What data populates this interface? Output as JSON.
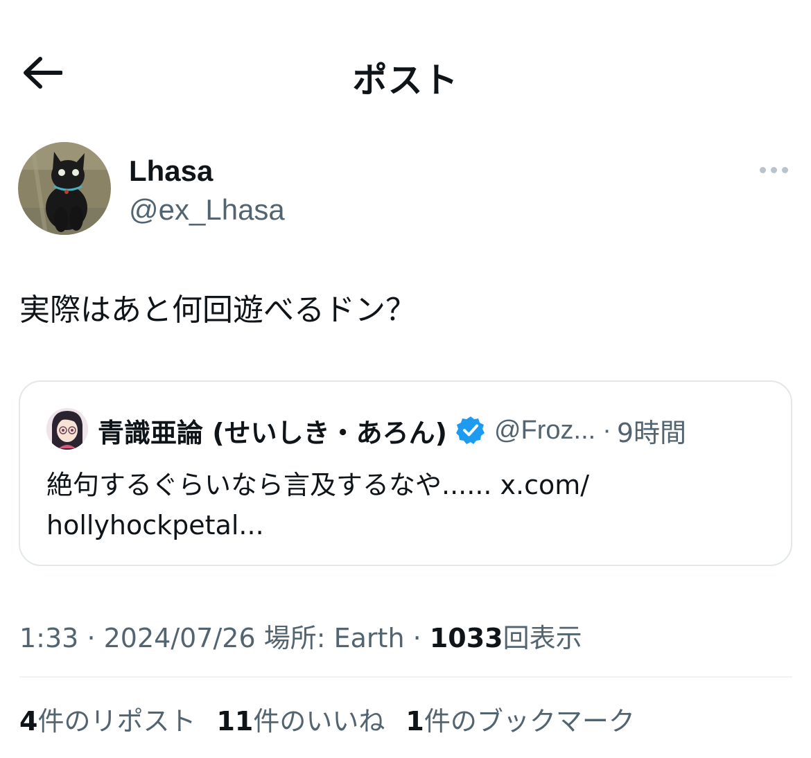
{
  "header": {
    "title": "ポスト",
    "back_icon": "arrow-left-icon"
  },
  "author": {
    "name": "Lhasa",
    "handle": "@ex_Lhasa",
    "avatar": "black-cat-photo",
    "more_icon": "more-horizontal-icon"
  },
  "tweet": {
    "text": "実際はあと何回遊べるドン？"
  },
  "quote": {
    "name": "青識亜論 (せいしき・あろん)",
    "verified_icon": "verified-badge-icon",
    "verified_color": "#1d9bf0",
    "handle": "@Froz...",
    "separator": "·",
    "time": "9時間",
    "text_line1": "絶句するぐらいなら言及するなや...... x.com/",
    "text_line2": "hollyhockpetal..."
  },
  "meta": {
    "time": "1:33",
    "sep1": "·",
    "date": "2024/07/26",
    "location": "場所: Earth",
    "sep2": "·",
    "views_count": "1033",
    "views_label": "回表示"
  },
  "stats": {
    "reposts_count": "4",
    "reposts_label": "件のリポスト",
    "likes_count": "11",
    "likes_label": "件のいいね",
    "bookmarks_count": "1",
    "bookmarks_label": "件のブックマーク"
  },
  "colors": {
    "text_primary": "#0f1419",
    "text_secondary": "#536471",
    "border": "#e2e7ea",
    "accent": "#1d9bf0"
  }
}
